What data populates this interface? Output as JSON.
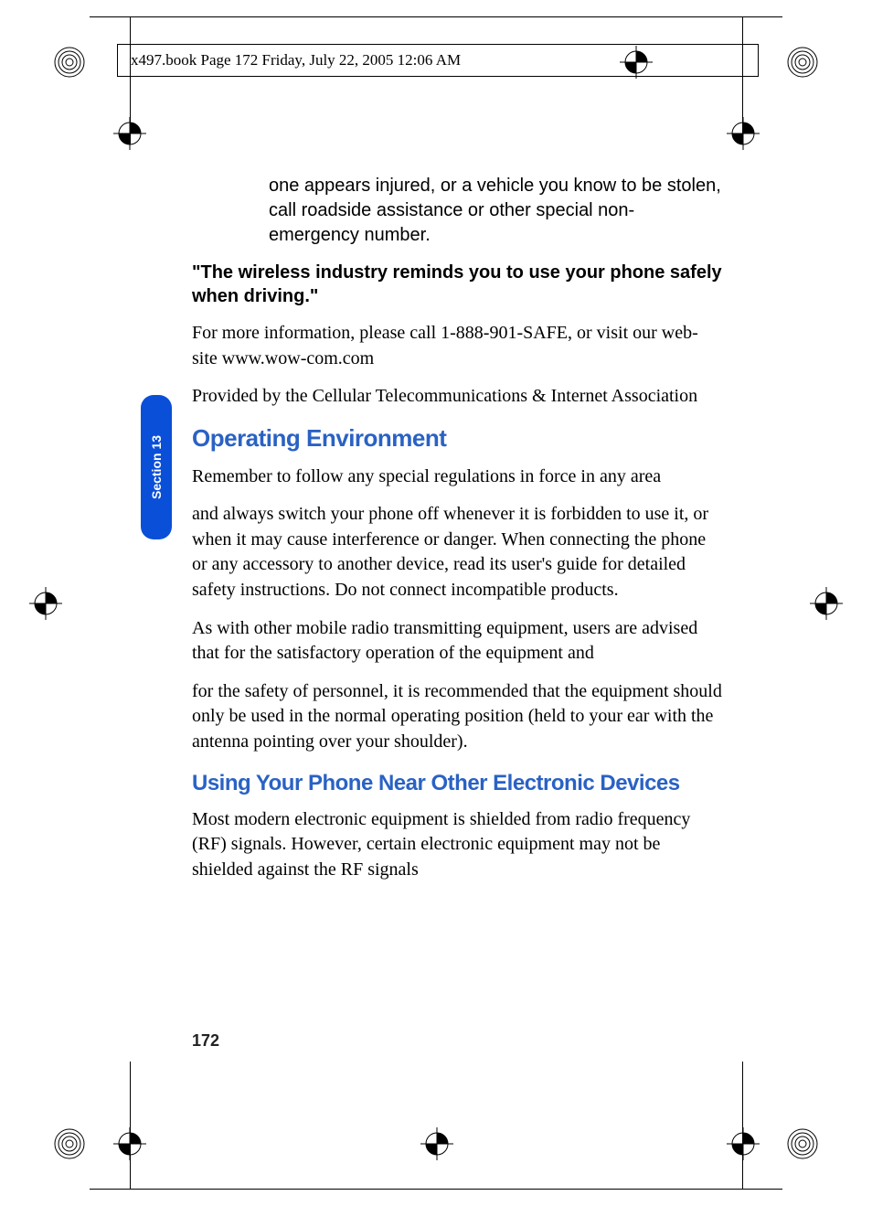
{
  "running_head": "x497.book  Page 172  Friday, July 22, 2005  12:06 AM",
  "side_tab": "Section 13",
  "page_number": "172",
  "paragraphs": {
    "p1": "one appears injured, or a vehicle you know to be stolen, call roadside assistance or other special non-emergency number.",
    "p2": "\"The wireless industry reminds you to use your phone safely when driving.\"",
    "p3": "For more information, please call 1-888-901-SAFE, or visit our web-site www.wow-com.com",
    "p4": "Provided by the Cellular Telecommunications & Internet Association",
    "h2a": "Operating Environment",
    "p5": "Remember to follow any special regulations in force in any area",
    "p6": "and always switch your phone off whenever it is forbidden to use it, or when it may cause interference or danger. When connecting the phone or any accessory to another device, read its user's guide for detailed safety instructions. Do not connect incompatible products.",
    "p7": "As with other mobile radio transmitting equipment, users are advised that for the satisfactory operation of the equipment and",
    "p8": "for the safety of personnel, it is recommended that the equipment should only be used in the normal operating position (held to your ear with the antenna pointing over your shoulder).",
    "h2b": "Using Your Phone Near Other Electronic Devices",
    "p9": "Most modern electronic equipment is shielded from radio frequency (RF) signals. However, certain electronic equipment may not be shielded against the RF signals"
  }
}
